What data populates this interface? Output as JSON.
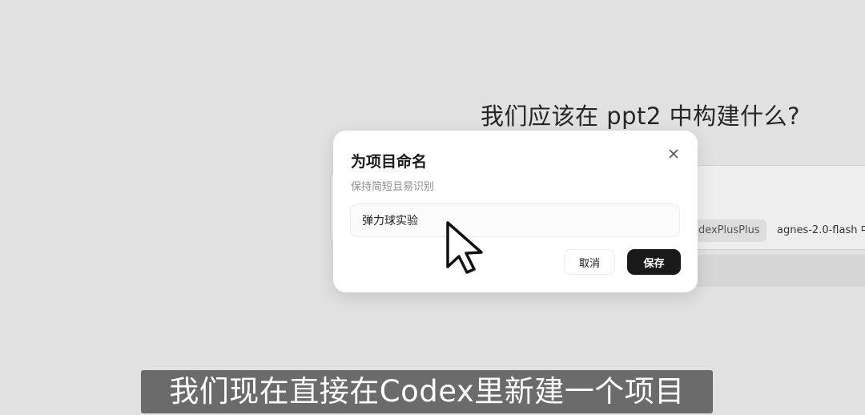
{
  "background": {
    "heading": "我们应该在 ppt2 中构建什么?",
    "chips": {
      "codex": "odexPlusPlus",
      "model": "agnes-2.0-flash 中"
    }
  },
  "dialog": {
    "title": "为项目命名",
    "subtitle": "保持简短且易识别",
    "input_value": "弹力球实验",
    "close_icon": "close-icon",
    "cancel_label": "取消",
    "save_label": "保存"
  },
  "caption": {
    "text": "我们现在直接在Codex里新建一个项目"
  },
  "colors": {
    "primary_button": "#1a1a1a",
    "backdrop": "#e1e1e1"
  }
}
